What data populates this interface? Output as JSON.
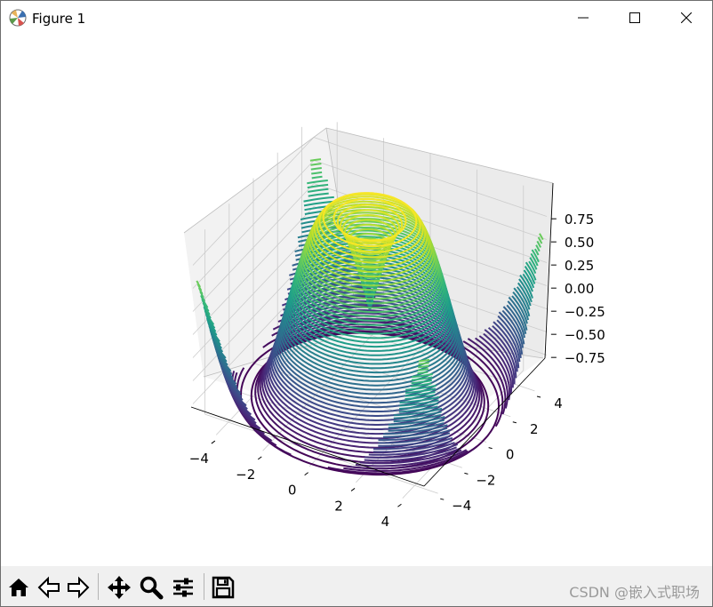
{
  "window": {
    "title": "Figure 1",
    "controls": [
      "minimize",
      "maximize",
      "close"
    ]
  },
  "toolbar": {
    "tools": [
      "home-icon",
      "back-icon",
      "forward-icon",
      "pan-icon",
      "zoom-icon",
      "configure-subplots-icon",
      "save-icon"
    ],
    "watermark": "CSDN @嵌入式职场"
  },
  "colors": {
    "viridis_low": "#440154",
    "viridis_mid": "#21918c",
    "viridis_high": "#fde725",
    "pane": "#f2f2f2",
    "grid": "#cccccc"
  },
  "chart_data": {
    "type": "contour3d",
    "function": "z = sin(sqrt(x^2 + y^2))",
    "colormap": "viridis",
    "levels": 50,
    "xlim": [
      -5,
      5
    ],
    "ylim": [
      -5,
      5
    ],
    "zlim": [
      -1,
      1
    ],
    "x_ticks": [
      "−4",
      "−2",
      "0",
      "2",
      "4"
    ],
    "y_ticks": [
      "−4",
      "−2",
      "0",
      "2",
      "4"
    ],
    "z_ticks": [
      "0.75",
      "0.50",
      "0.25",
      "0.00",
      "−0.25",
      "−0.50",
      "−0.75"
    ],
    "title": "",
    "xlabel": "",
    "ylabel": "",
    "zlabel": "",
    "grid": true
  }
}
